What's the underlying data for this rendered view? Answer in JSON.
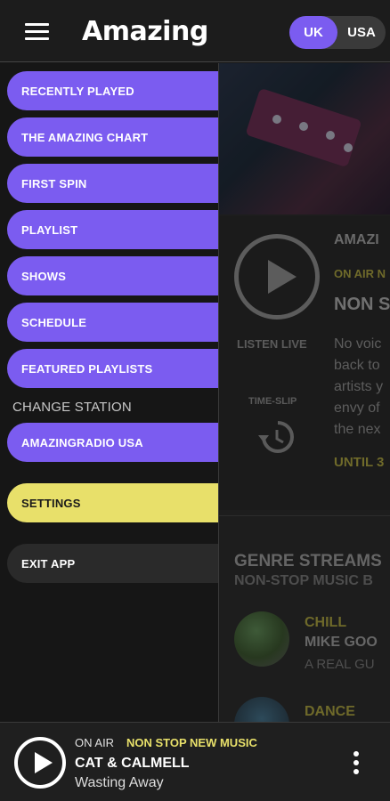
{
  "header": {
    "logo_text": "Amazing",
    "regions": {
      "uk": "UK",
      "usa": "USA",
      "selected": "UK"
    }
  },
  "drawer": {
    "items": [
      {
        "label": "RECENTLY PLAYED"
      },
      {
        "label": "THE AMAZING CHART"
      },
      {
        "label": "FIRST SPIN"
      },
      {
        "label": "PLAYLIST"
      },
      {
        "label": "SHOWS"
      },
      {
        "label": "SCHEDULE"
      },
      {
        "label": "FEATURED PLAYLISTS"
      }
    ],
    "section_label": "CHANGE STATION",
    "station_item": "AMAZINGRADIO USA",
    "settings_label": "SETTINGS",
    "exit_label": "EXIT APP"
  },
  "background": {
    "program_title": "AMAZI",
    "on_air_label": "ON AIR N",
    "show_name": "NON S",
    "listen_live": "LISTEN LIVE",
    "time_slip": "TIME-SLIP",
    "description_lines": [
      "No voic",
      "back to",
      "artists y",
      "envy of",
      "the nex"
    ],
    "until_text": "UNTIL 3",
    "genre_title": "GENRE STREAMS",
    "genre_subtitle": "NON-STOP MUSIC B",
    "genres": [
      {
        "name": "CHILL",
        "artist": "MIKE GOO",
        "track": "A REAL GU"
      },
      {
        "name": "DANCE"
      }
    ]
  },
  "now_playing": {
    "on_air_label": "ON AIR",
    "show": "NON STOP NEW MUSIC",
    "artist": "CAT & CALMELL",
    "track": "Wasting Away"
  },
  "colors": {
    "accent_purple": "#7b5cf0",
    "accent_yellow": "#e8e06a",
    "background": "#161616"
  },
  "icons": {
    "menu": "hamburger-icon",
    "play": "play-icon",
    "time_slip": "history-icon",
    "more": "more-vertical-icon"
  }
}
